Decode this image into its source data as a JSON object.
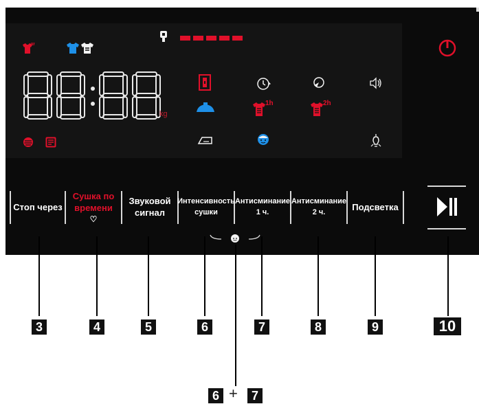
{
  "colors": {
    "red": "#e0102a",
    "blue": "#1e90e8",
    "white": "#f2f2f2",
    "panel": "#0b0b0b"
  },
  "display": {
    "time_readout": "88:88",
    "kg_unit": "kg",
    "icons": [
      "shirt-dry-red-icon",
      "shirt-blue-icon",
      "shirt-dry-white-icon",
      "lock-key-icon",
      "level-dashes-icon",
      "door-lock-icon",
      "timer-icon",
      "rotation-icon",
      "sound-icon",
      "iron-blue-icon",
      "shirt-1h-icon",
      "shirt-2h-icon",
      "wool-icon",
      "list-icon",
      "iron-low-icon",
      "face-blue-icon",
      "light-bulb-icon",
      "power-icon"
    ],
    "shirt_1h": "1h",
    "shirt_2h": "2h"
  },
  "buttons": [
    {
      "label": "Стоп через",
      "sub": ""
    },
    {
      "label": "Сушка по",
      "sub": "времени",
      "color": "#e0102a"
    },
    {
      "label": "Звуковой",
      "sub": "сигнал"
    },
    {
      "label": "Интенсивность",
      "sub": "сушки"
    },
    {
      "label": "Антисминание",
      "sub": "1 ч."
    },
    {
      "label": "Антисминание",
      "sub": "2 ч."
    },
    {
      "label": "Подсветка",
      "sub": ""
    }
  ],
  "heart_symbol": "♡",
  "callouts": [
    "3",
    "4",
    "5",
    "6",
    "7",
    "8",
    "9",
    "10"
  ],
  "combo": {
    "left": "6",
    "plus": "+",
    "right": "7"
  }
}
